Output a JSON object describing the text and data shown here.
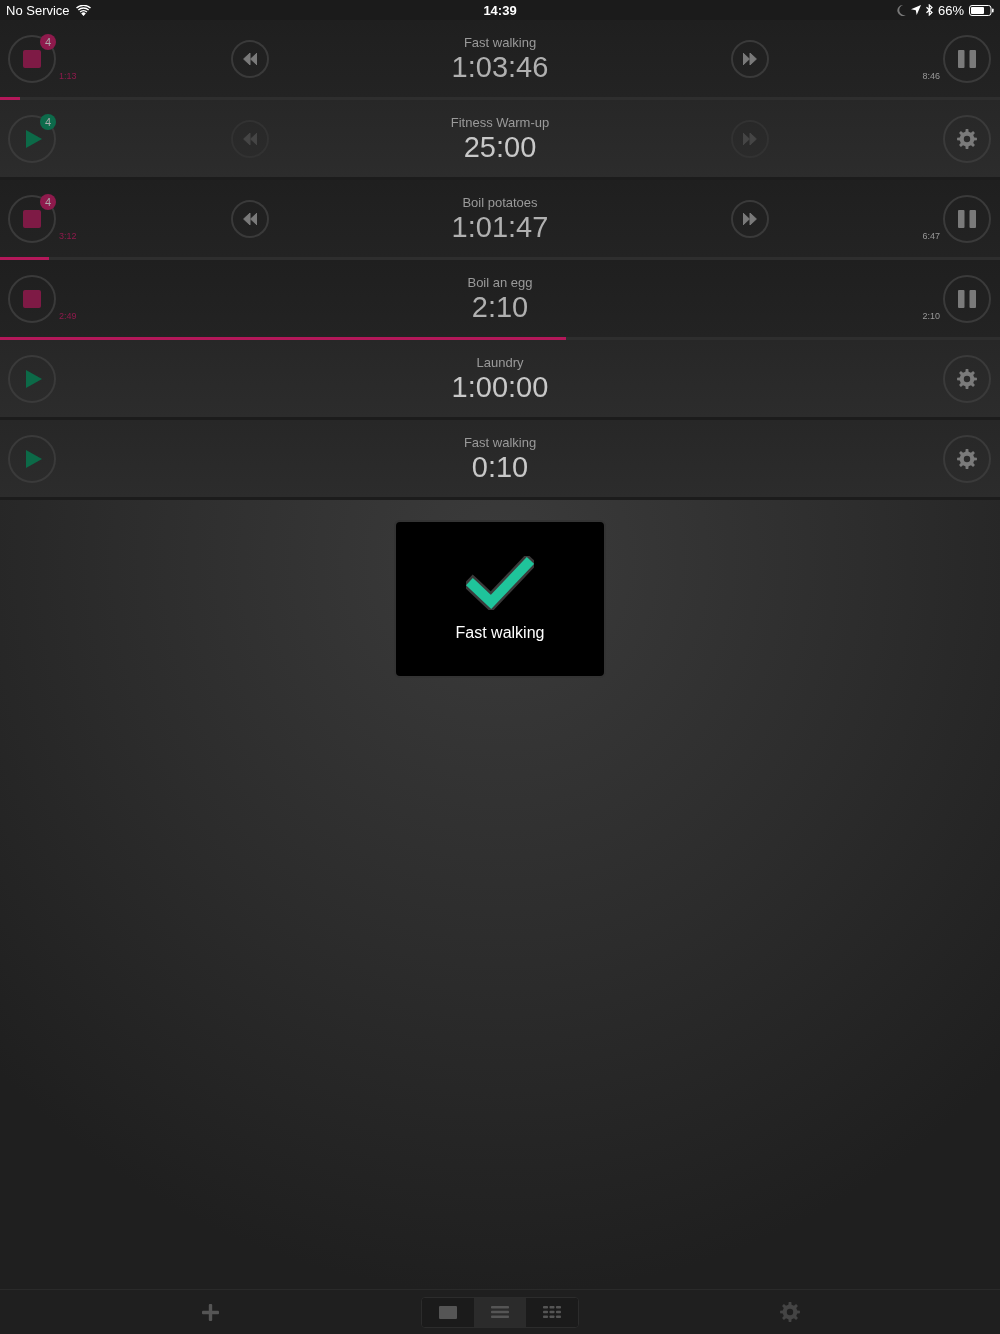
{
  "status_bar": {
    "carrier": "No Service",
    "time": "14:39",
    "battery": "66%"
  },
  "timers": [
    {
      "name": "Fast walking",
      "time": "1:03:46",
      "running": true,
      "badge": "4",
      "elapsed": "1:13",
      "remaining": "8:46",
      "rewind": {
        "disabled": false
      },
      "forward": {
        "disabled": false
      },
      "level": 0.02
    },
    {
      "name": "Fitness Warm-up",
      "time": "25:00",
      "running": false,
      "badge": "4",
      "rewind": {
        "disabled": true
      },
      "forward": {
        "disabled": true
      }
    },
    {
      "name": "Boil potatoes",
      "time": "1:01:47",
      "running": true,
      "badge": "4",
      "elapsed": "3:12",
      "remaining": "6:47",
      "rewind": {
        "disabled": false
      },
      "forward": {
        "disabled": false
      },
      "level": 0.049
    },
    {
      "name": "Boil an egg",
      "time": "2:10",
      "running": true,
      "elapsed": "2:49",
      "remaining": "2:10",
      "level": 0.566
    },
    {
      "name": "Laundry",
      "time": "1:00:00",
      "running": false
    },
    {
      "name": "Fast walking",
      "time": "0:10",
      "running": false
    }
  ],
  "toast": {
    "message": "Fast walking"
  },
  "toolbar": {
    "views": [
      {
        "kind": "cards",
        "selected": false
      },
      {
        "kind": "list",
        "selected": true
      },
      {
        "kind": "grid",
        "selected": false
      }
    ]
  }
}
